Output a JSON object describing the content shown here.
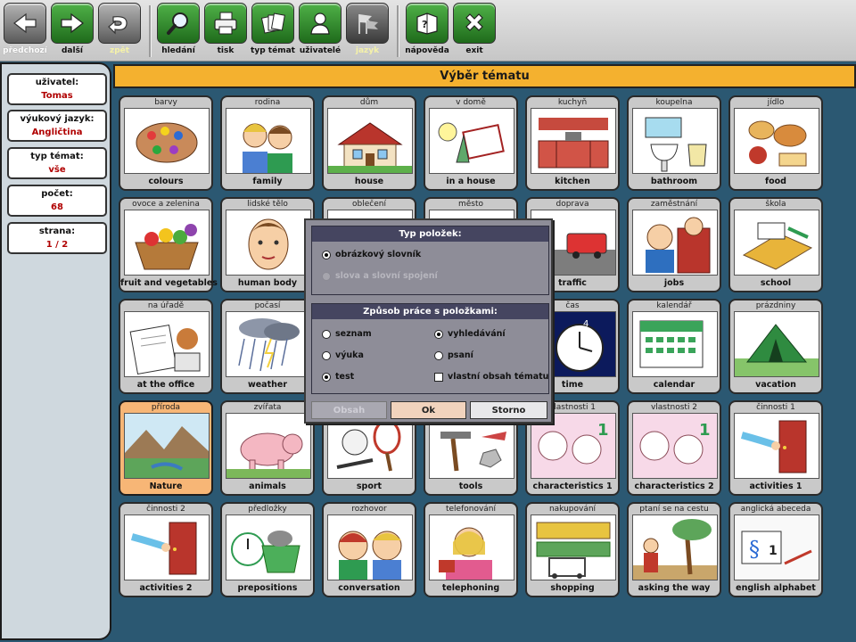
{
  "toolbar": {
    "back": "předchozí",
    "next": "další",
    "return": "zpět",
    "search": "hledání",
    "print": "tisk",
    "topic_type": "typ témat",
    "users": "uživatelé",
    "language": "jazyk",
    "help": "nápověda",
    "exit": "exit"
  },
  "sidebar": {
    "user_label": "uživatel:",
    "user_value": "Tomas",
    "lang_label": "výukový jazyk:",
    "lang_value": "Angličtina",
    "type_label": "typ témat:",
    "type_value": "vše",
    "count_label": "počet:",
    "count_value": "68",
    "page_label": "strana:",
    "page_value": "1 / 2"
  },
  "title": "Výběr tématu",
  "topics": [
    {
      "cz": "barvy",
      "en": "colours",
      "icon": "palette-picture"
    },
    {
      "cz": "rodina",
      "en": "family",
      "icon": "family-picture"
    },
    {
      "cz": "dům",
      "en": "house",
      "icon": "house-picture"
    },
    {
      "cz": "v domě",
      "en": "in a house",
      "icon": "household-objects-picture"
    },
    {
      "cz": "kuchyň",
      "en": "kitchen",
      "icon": "kitchen-picture"
    },
    {
      "cz": "koupelna",
      "en": "bathroom",
      "icon": "bathroom-picture"
    },
    {
      "cz": "jídlo",
      "en": "food",
      "icon": "food-picture"
    },
    {
      "cz": "ovoce a zelenina",
      "en": "fruit and vegetables",
      "icon": "fruit-basket-picture"
    },
    {
      "cz": "lidské tělo",
      "en": "human body",
      "icon": "human-face-picture"
    },
    {
      "cz": "oblečení",
      "en": "",
      "icon": "clothes-picture"
    },
    {
      "cz": "město",
      "en": "",
      "icon": "city-picture"
    },
    {
      "cz": "doprava",
      "en": "traffic",
      "icon": "traffic-picture"
    },
    {
      "cz": "zaměstnání",
      "en": "jobs",
      "icon": "jobs-picture"
    },
    {
      "cz": "škola",
      "en": "school",
      "icon": "school-picture"
    },
    {
      "cz": "na úřadě",
      "en": "at the office",
      "icon": "office-picture"
    },
    {
      "cz": "počasí",
      "en": "weather",
      "icon": "weather-picture"
    },
    {
      "cz": "",
      "en": "",
      "icon": "hidden-picture"
    },
    {
      "cz": "",
      "en": "",
      "icon": "hidden-picture"
    },
    {
      "cz": "čas",
      "en": "time",
      "icon": "clock-picture"
    },
    {
      "cz": "kalendář",
      "en": "calendar",
      "icon": "calendar-picture"
    },
    {
      "cz": "prázdniny",
      "en": "vacation",
      "icon": "tent-picture"
    },
    {
      "cz": "příroda",
      "en": "Nature",
      "icon": "nature-picture"
    },
    {
      "cz": "zvířata",
      "en": "animals",
      "icon": "pig-picture"
    },
    {
      "cz": "",
      "en": "sport",
      "icon": "sport-picture"
    },
    {
      "cz": "",
      "en": "tools",
      "icon": "tools-picture"
    },
    {
      "cz": "vlastnosti 1",
      "en": "characteristics 1",
      "icon": "characteristics-picture"
    },
    {
      "cz": "vlastnosti 2",
      "en": "characteristics 2",
      "icon": "characteristics-picture"
    },
    {
      "cz": "činnosti 1",
      "en": "activities 1",
      "icon": "door-picture"
    },
    {
      "cz": "činnosti 2",
      "en": "activities 2",
      "icon": "door-picture"
    },
    {
      "cz": "předložky",
      "en": "prepositions",
      "icon": "cat-basket-picture"
    },
    {
      "cz": "rozhovor",
      "en": "conversation",
      "icon": "conversation-picture"
    },
    {
      "cz": "telefonování",
      "en": "telephoning",
      "icon": "telephone-picture"
    },
    {
      "cz": "nakupování",
      "en": "shopping",
      "icon": "shopping-picture"
    },
    {
      "cz": "ptaní se na cestu",
      "en": "asking the way",
      "icon": "asking-way-picture"
    },
    {
      "cz": "anglická abeceda",
      "en": "english alphabet",
      "icon": "alphabet-picture"
    }
  ],
  "dialog": {
    "items_header": "Typ položek:",
    "opt_picture_dict": "obrázkový slovník",
    "opt_words": "slova a slovní spojení",
    "work_header": "Způsob práce s položkami:",
    "opt_list": "seznam",
    "opt_search": "vyhledávání",
    "opt_teaching": "výuka",
    "opt_writing": "psaní",
    "opt_test": "test",
    "opt_own": "vlastní obsah tématu",
    "btn_content": "Obsah",
    "btn_ok": "Ok",
    "btn_cancel": "Storno"
  },
  "colors": {
    "background": "#2b5872",
    "title_bar": "#f4b12f",
    "selected_card": "#f7b676",
    "dialog": "#8e8d98"
  }
}
